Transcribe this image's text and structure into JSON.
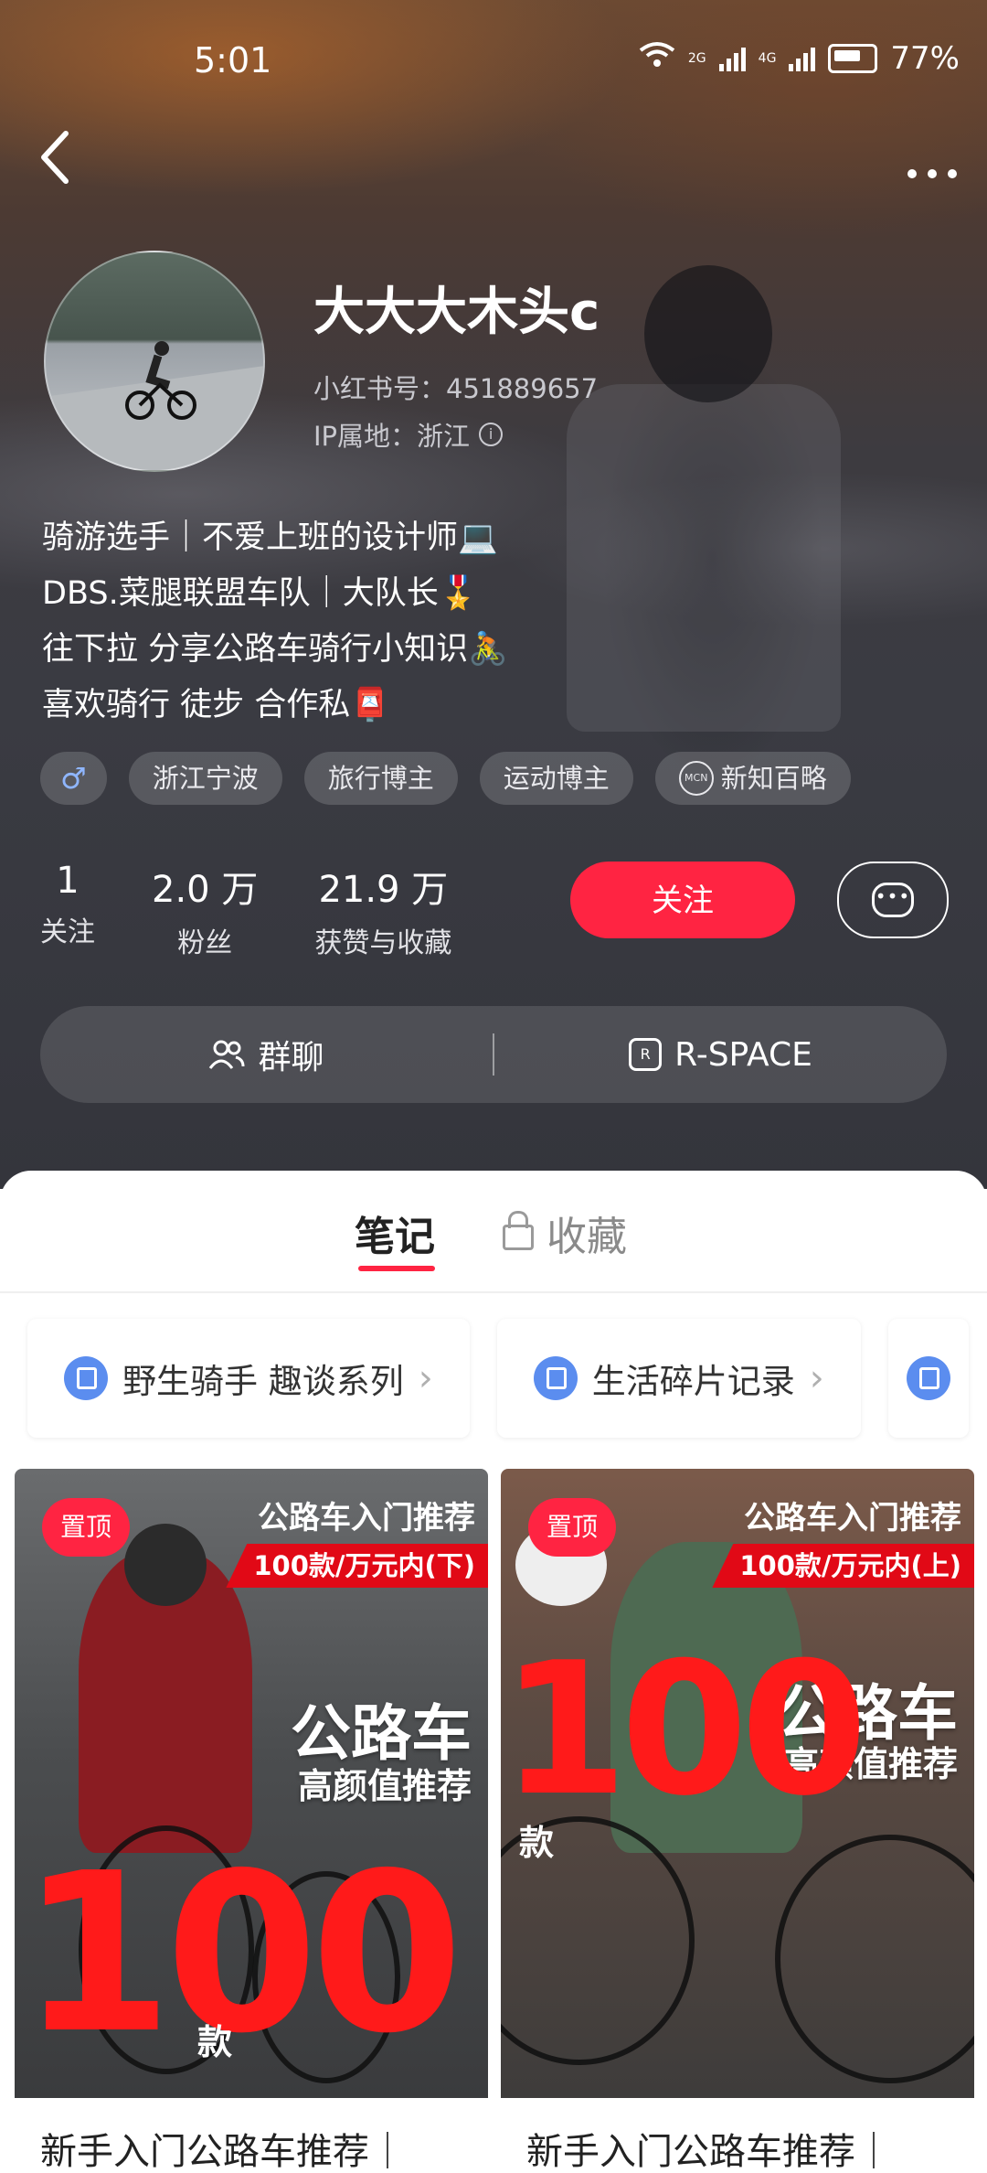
{
  "status_bar": {
    "time": "5:01",
    "network_1": "6",
    "network_2": "2G",
    "network_3": "4G",
    "battery": "77%"
  },
  "nav": {
    "back_icon": "chevron-left-icon",
    "more_icon": "more-dots-icon"
  },
  "profile": {
    "name": "大大大木头c",
    "xhs_id": "小红书号：451889657",
    "ip": "IP属地：浙江",
    "bio": [
      "骑游选手｜不爱上班的设计师💻",
      "DBS.菜腿联盟车队｜大队长🎖️",
      "往下拉 分享公路车骑行小知识🚴",
      "喜欢骑行 徒步 合作私📮"
    ],
    "gender_symbol": "♂",
    "tags": [
      "浙江宁波",
      "旅行博主",
      "运动博主",
      "新知百略"
    ],
    "mcn_label": "MCN"
  },
  "stats": [
    {
      "num": "1",
      "label": "关注"
    },
    {
      "num": "2.0 万",
      "label": "粉丝"
    },
    {
      "num": "21.9 万",
      "label": "获赞与收藏"
    }
  ],
  "actions": {
    "follow": "关注",
    "chat_glyph": "•••"
  },
  "groupbar": {
    "group_chat": "群聊",
    "rspace": "R-SPACE",
    "rspace_glyph": "R"
  },
  "tabs": {
    "notes": "笔记",
    "favorites": "收藏"
  },
  "collections": [
    {
      "label": "野生骑手 趣谈系列"
    },
    {
      "label": "生活碎片记录"
    }
  ],
  "cards": [
    {
      "pin": "置顶",
      "title": "公路车入门推荐",
      "subtitle": "100款/万元内(下)",
      "big_text": "公路车",
      "big_sub": "高颜值推荐",
      "number": "100",
      "unit": "款",
      "caption": "新手入门公路车推荐｜"
    },
    {
      "pin": "置顶",
      "title": "公路车入门推荐",
      "subtitle": "100款/万元内(上)",
      "big_text": "公路车",
      "big_sub": "高颜值推荐",
      "number": "100",
      "unit": "款",
      "caption": "新手入门公路车推荐｜"
    }
  ],
  "colors": {
    "accent": "#ff2442",
    "link_blue": "#5b8def"
  }
}
